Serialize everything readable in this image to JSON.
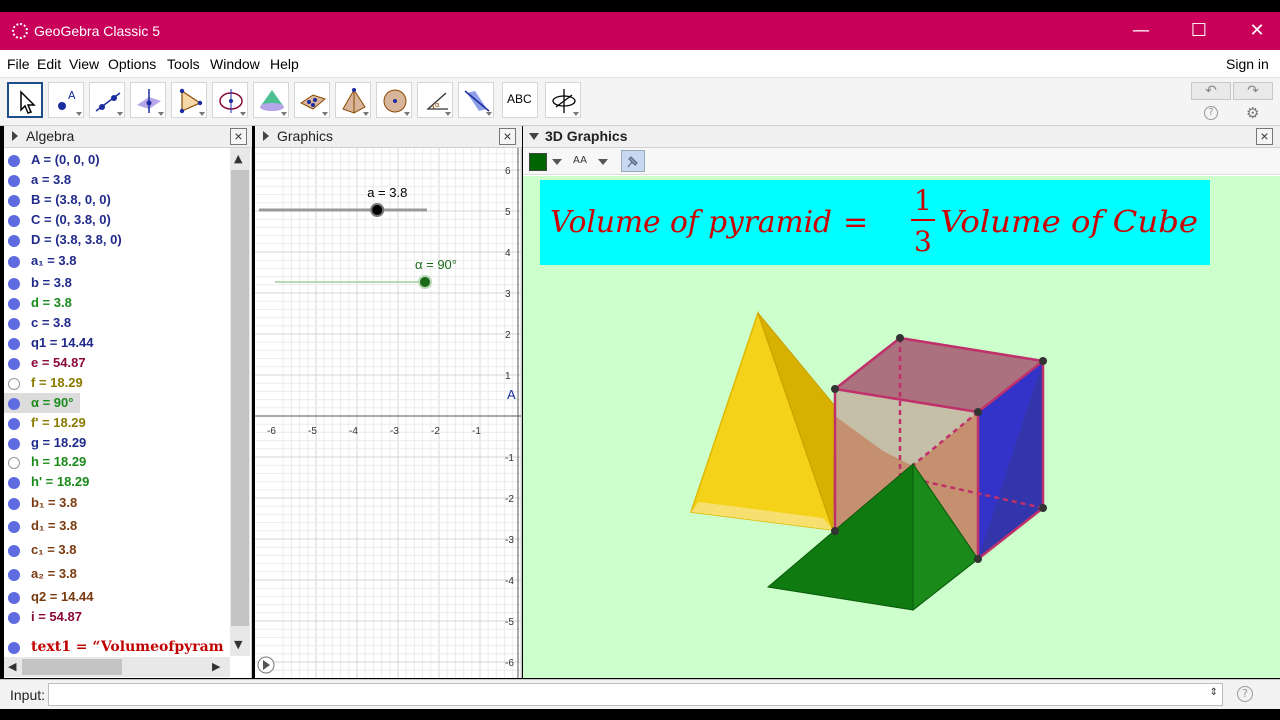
{
  "window": {
    "title": "GeoGebra Classic 5",
    "minimize": "—",
    "maximize": "☐",
    "close": "✕"
  },
  "menu": [
    "File",
    "Edit",
    "View",
    "Options",
    "Tools",
    "Window",
    "Help"
  ],
  "sign_in": "Sign in",
  "toolbar": {
    "tools": [
      "move-tool",
      "point-tool",
      "line-tool",
      "perpendicular-tool",
      "polygon-tool",
      "circle-tool",
      "cone-tool",
      "plane-tool",
      "pyramid-tool",
      "sphere-tool",
      "angle-tool",
      "reflect-tool",
      "text-tool",
      "rotate-view-tool"
    ],
    "text_tool_label": "ABC",
    "undo": "↶",
    "redo": "↷",
    "help": "?",
    "settings": "⚙"
  },
  "algebra": {
    "title": "Algebra",
    "items": [
      {
        "text": "A = (0, 0, 0)",
        "color": "blue",
        "visible": true
      },
      {
        "text": "a = 3.8",
        "color": "blue",
        "visible": true
      },
      {
        "text": "B = (3.8, 0, 0)",
        "color": "blue",
        "visible": true
      },
      {
        "text": "C = (0, 3.8, 0)",
        "color": "blue",
        "visible": true
      },
      {
        "text": "D = (3.8, 3.8, 0)",
        "color": "blue",
        "visible": true
      },
      {
        "text": "a₁ = 3.8",
        "color": "blue",
        "visible": true
      },
      {
        "text": "b = 3.8",
        "color": "blue",
        "visible": true
      },
      {
        "text": "d = 3.8",
        "color": "green",
        "visible": true
      },
      {
        "text": "c = 3.8",
        "color": "blue",
        "visible": true
      },
      {
        "text": "q1 = 14.44",
        "color": "blue",
        "visible": true
      },
      {
        "text": "e = 54.87",
        "color": "maroon",
        "visible": true
      },
      {
        "text": "f = 18.29",
        "color": "olive",
        "visible": false
      },
      {
        "text": "α = 90°",
        "color": "green",
        "visible": true
      },
      {
        "text": "f' = 18.29",
        "color": "olive",
        "visible": true
      },
      {
        "text": "g = 18.29",
        "color": "blue",
        "visible": true
      },
      {
        "text": "h = 18.29",
        "color": "green",
        "visible": false
      },
      {
        "text": "h' = 18.29",
        "color": "green",
        "visible": true
      },
      {
        "text": "b₁ = 3.8",
        "color": "brown",
        "visible": true
      },
      {
        "text": "d₁ = 3.8",
        "color": "brown",
        "visible": true
      },
      {
        "text": "c₁ = 3.8",
        "color": "brown",
        "visible": true
      },
      {
        "text": "a₂ = 3.8",
        "color": "brown",
        "visible": true
      },
      {
        "text": "q2 = 14.44",
        "color": "brown",
        "visible": true
      },
      {
        "text": "i = 54.87",
        "color": "maroon",
        "visible": true
      },
      {
        "text": "text1  =  “Volumeofpyram",
        "color": "red",
        "visible": true
      }
    ]
  },
  "graphics": {
    "title": "Graphics",
    "x_ticks": [
      "-6",
      "-5",
      "-4",
      "-3",
      "-2",
      "-1"
    ],
    "y_ticks": [
      "6",
      "5",
      "4",
      "3",
      "2",
      "1",
      "-1",
      "-2",
      "-3",
      "-4",
      "-5",
      "-6"
    ],
    "axis_label": "A",
    "slider_a_label": "a = 3.8",
    "slider_a_value": 3.8,
    "slider_alpha_label": "α = 90°",
    "slider_alpha_value": 90
  },
  "graphics3d": {
    "title": "3D Graphics",
    "style_color": "#006400",
    "font_btn": "AA",
    "formula": {
      "left": "Volume of pyramid",
      "equals": "=",
      "numerator": "1",
      "denominator": "3",
      "right": "Volume of Cube"
    }
  },
  "input": {
    "label": "Input:",
    "value": "",
    "help": "?"
  },
  "colors": {
    "titlebar": "#c8005a",
    "graphics3d_bg": "#ccffcc",
    "formula_bg": "#00ffff",
    "formula_text": "#cc0000"
  }
}
